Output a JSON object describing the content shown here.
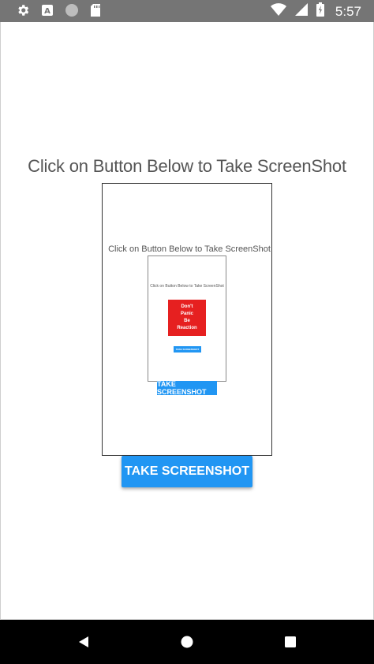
{
  "status_bar": {
    "time": "5:57",
    "left_icons": [
      "gear-icon",
      "app-a-icon",
      "circle-icon",
      "sdcard-icon"
    ],
    "right_icons": [
      "wifi-icon",
      "signal-icon",
      "battery-icon"
    ]
  },
  "main": {
    "title": "Click on Button Below to Take ScreenShot",
    "button_label": "TAKE SCREENSHOT"
  },
  "screenshot_preview": {
    "title": "Click on Button Below to Take ScreenShot",
    "button_label": "TAKE SCREENSHOT",
    "nested_preview": {
      "title": "Click on Button Below to Take ScreenShot",
      "image_lines": [
        "Don't",
        "Panic",
        "Be",
        "Reaction"
      ],
      "button_label": "TAKE SCREENSHOT"
    }
  },
  "nav_bar": {
    "buttons": [
      "back-icon",
      "home-icon",
      "recents-icon"
    ]
  },
  "colors": {
    "accent": "#2196F3",
    "status_bar": "#757575",
    "red_image": "#E62020"
  }
}
